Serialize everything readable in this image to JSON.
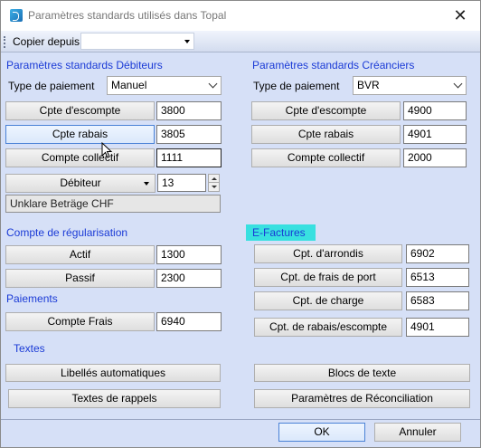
{
  "window": {
    "title": "Paramètres standards utilisés dans Topal",
    "close_glyph": "✕"
  },
  "toolbar": {
    "copy_label": "Copier depuis",
    "copy_value": ""
  },
  "debiteurs": {
    "section_title": "Paramètres standards Débiteurs",
    "payment_type_label": "Type de paiement",
    "payment_type_value": "Manuel",
    "escompte_label": "Cpte d'escompte",
    "escompte_value": "3800",
    "rabais_label": "Cpte rabais",
    "rabais_value": "3805",
    "collectif_label": "Compte collectif",
    "collectif_value": "1111",
    "debiteur_combo": "Débiteur",
    "debiteur_number": "13",
    "unclear_text": "Unklare Beträge CHF"
  },
  "creanciers": {
    "section_title": "Paramètres standards Créanciers",
    "payment_type_label": "Type de paiement",
    "payment_type_value": "BVR",
    "escompte_label": "Cpte d'escompte",
    "escompte_value": "4900",
    "rabais_label": "Cpte rabais",
    "rabais_value": "4901",
    "collectif_label": "Compte collectif",
    "collectif_value": "2000"
  },
  "regularisation": {
    "section_title": "Compte de régularisation",
    "actif_label": "Actif",
    "actif_value": "1300",
    "passif_label": "Passif",
    "passif_value": "2300"
  },
  "paiements": {
    "section_title": "Paiements",
    "frais_label": "Compte Frais",
    "frais_value": "6940"
  },
  "efactures": {
    "section_title": "E-Factures",
    "arrondis_label": "Cpt. d'arrondis",
    "arrondis_value": "6902",
    "port_label": "Cpt. de frais de port",
    "port_value": "6513",
    "charge_label": "Cpt. de charge",
    "charge_value": "6583",
    "rabais_escompte_label": "Cpt. de rabais/escompte",
    "rabais_escompte_value": "4901"
  },
  "textes": {
    "section_title": "Textes",
    "libelles_label": "Libellés automatiques",
    "rappels_label": "Textes de rappels",
    "blocs_label": "Blocs de texte",
    "reconciliation_label": "Paramètres de Réconciliation"
  },
  "footer": {
    "ok_label": "OK",
    "cancel_label": "Annuler"
  },
  "colors": {
    "background": "#d6e0f7",
    "section_title": "#1a3ad6",
    "efactures_highlight": "#38e0e0",
    "focus_border": "#4a82d6"
  }
}
